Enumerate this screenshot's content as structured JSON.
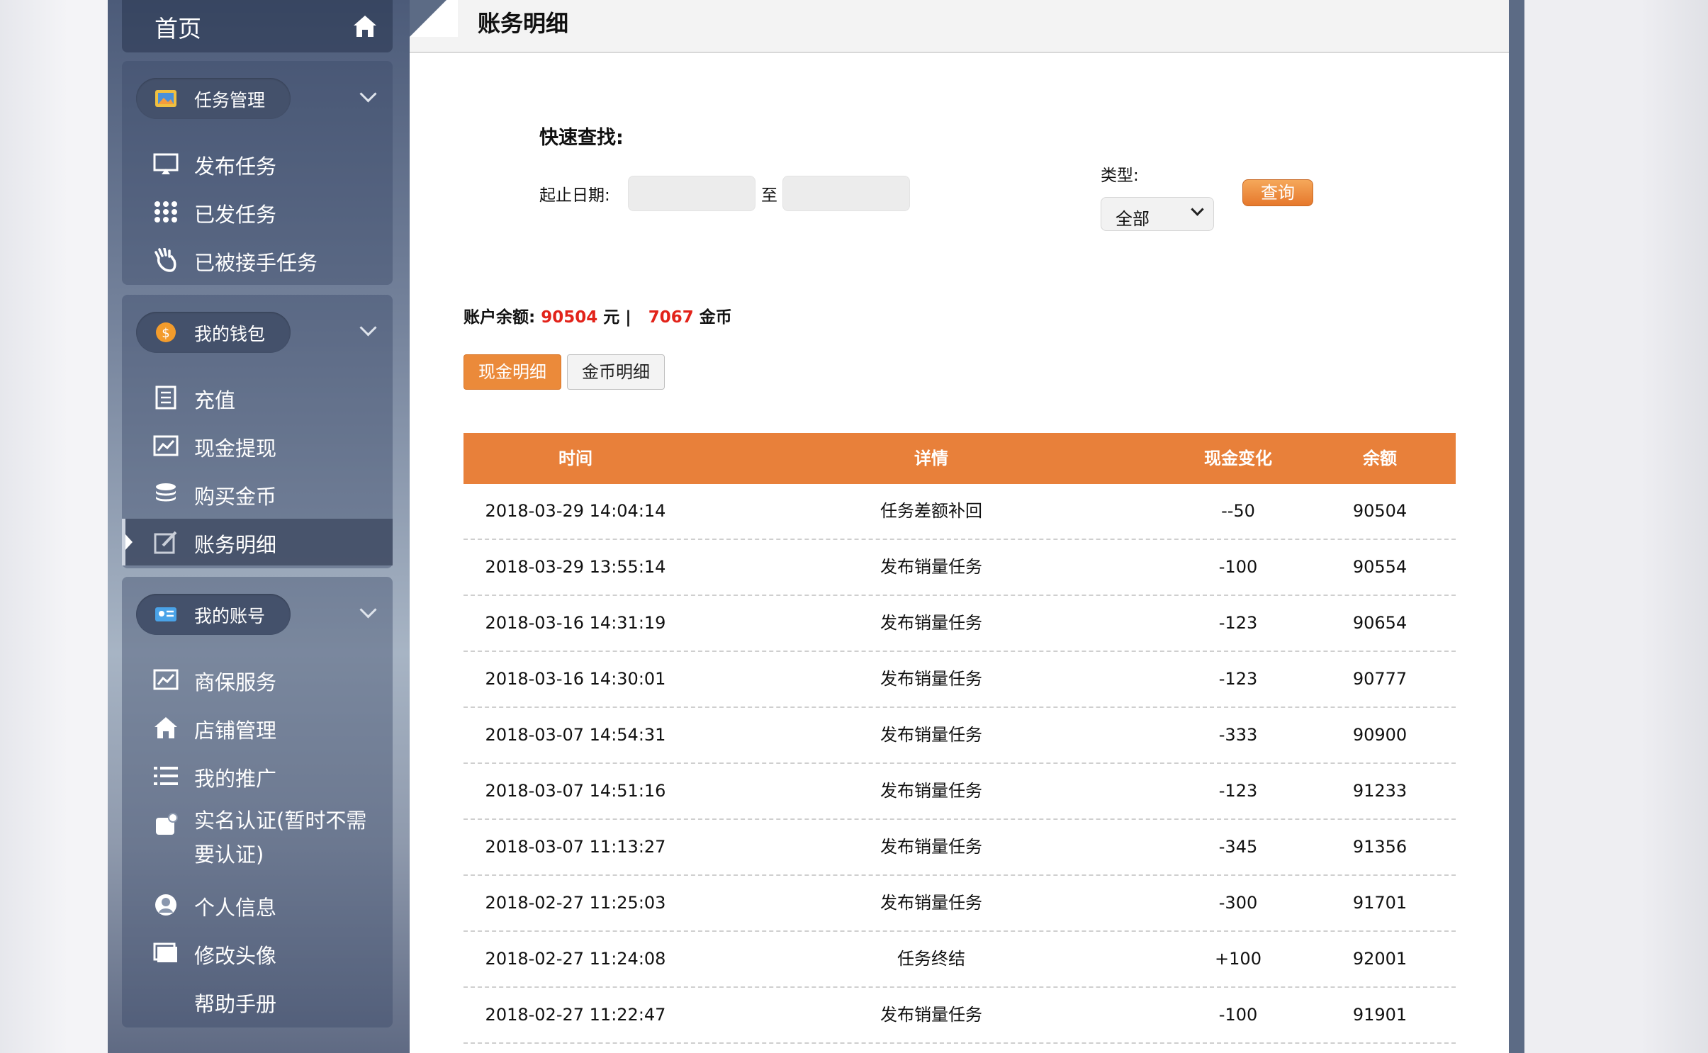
{
  "sidebar": {
    "home_label": "首页",
    "groups": [
      {
        "title": "任务管理",
        "items": [
          {
            "label": "发布任务",
            "icon": "monitor-icon"
          },
          {
            "label": "已发任务",
            "icon": "grid-icon"
          },
          {
            "label": "已被接手任务",
            "icon": "hand-icon"
          }
        ]
      },
      {
        "title": "我的钱包",
        "items": [
          {
            "label": "充值",
            "icon": "document-icon"
          },
          {
            "label": "现金提现",
            "icon": "chart-icon"
          },
          {
            "label": "购买金币",
            "icon": "coins-icon"
          },
          {
            "label": "账务明细",
            "icon": "edit-icon",
            "active": true
          }
        ]
      },
      {
        "title": "我的账号",
        "items": [
          {
            "label": "商保服务",
            "icon": "chart-icon"
          },
          {
            "label": "店铺管理",
            "icon": "home-icon"
          },
          {
            "label": "我的推广",
            "icon": "list-icon"
          },
          {
            "label": "实名认证(暂时不需要认证)",
            "icon": "id-icon"
          },
          {
            "label": "个人信息",
            "icon": "user-icon"
          },
          {
            "label": "修改头像",
            "icon": "window-icon"
          },
          {
            "label": "帮助手册",
            "icon": ""
          }
        ]
      }
    ]
  },
  "page": {
    "title": "账务明细",
    "quick_search": "快速查找:",
    "date_label": "起止日期:",
    "date_to": "至",
    "date_from_value": "",
    "date_to_value": "",
    "type_label": "类型:",
    "type_selected": "全部",
    "query_button": "查询",
    "balance_label": "账户余额:",
    "cash_balance": "90504",
    "cash_unit": "元 |",
    "coin_balance": "7067",
    "coin_unit": "金币",
    "tabs": [
      "现金明细",
      "金币明细"
    ],
    "accent_color": "#e8803a"
  },
  "table": {
    "headers": [
      "时间",
      "详情",
      "现金变化",
      "余额"
    ],
    "rows": [
      [
        "2018-03-29 14:04:14",
        "任务差额补回",
        "--50",
        "90504"
      ],
      [
        "2018-03-29 13:55:14",
        "发布销量任务",
        "-100",
        "90554"
      ],
      [
        "2018-03-16 14:31:19",
        "发布销量任务",
        "-123",
        "90654"
      ],
      [
        "2018-03-16 14:30:01",
        "发布销量任务",
        "-123",
        "90777"
      ],
      [
        "2018-03-07 14:54:31",
        "发布销量任务",
        "-333",
        "90900"
      ],
      [
        "2018-03-07 14:51:16",
        "发布销量任务",
        "-123",
        "91233"
      ],
      [
        "2018-03-07 11:13:27",
        "发布销量任务",
        "-345",
        "91356"
      ],
      [
        "2018-02-27 11:25:03",
        "发布销量任务",
        "-300",
        "91701"
      ],
      [
        "2018-02-27 11:24:08",
        "任务终结",
        "+100",
        "92001"
      ],
      [
        "2018-02-27 11:22:47",
        "发布销量任务",
        "-100",
        "91901"
      ]
    ]
  }
}
